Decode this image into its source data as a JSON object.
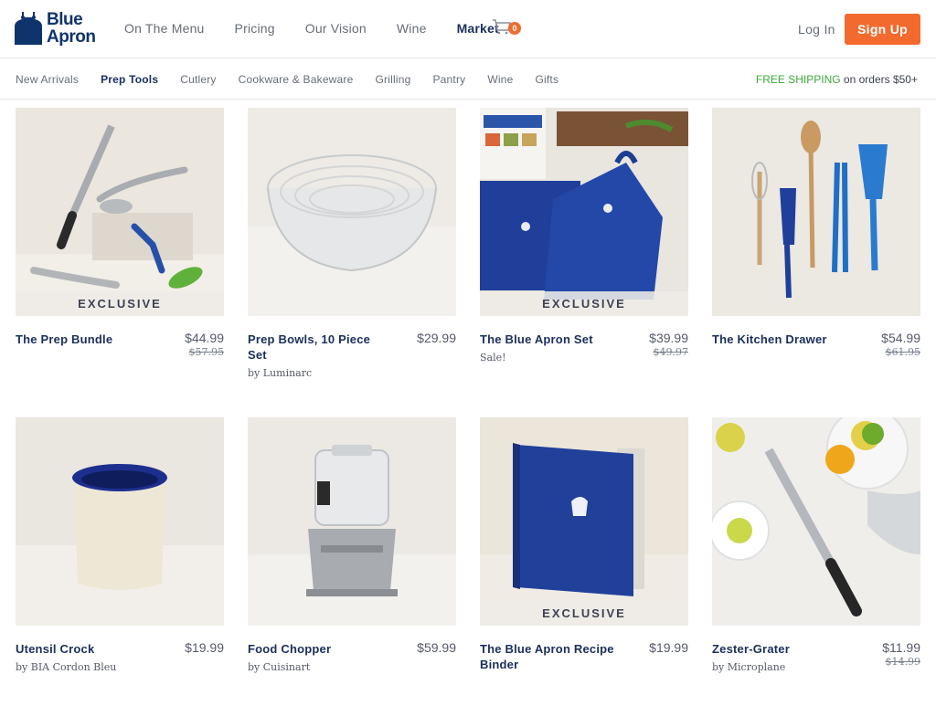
{
  "brand": {
    "line1": "Blue",
    "line2": "Apron"
  },
  "nav": [
    {
      "label": "On The Menu",
      "active": false
    },
    {
      "label": "Pricing",
      "active": false
    },
    {
      "label": "Our Vision",
      "active": false
    },
    {
      "label": "Wine",
      "active": false
    },
    {
      "label": "Market",
      "active": true
    }
  ],
  "cart": {
    "count": "0",
    "icon": "cart-icon"
  },
  "auth": {
    "login": "Log In",
    "signup": "Sign Up"
  },
  "colors": {
    "accent": "#f26a2e",
    "navy": "#1b2f5c",
    "green": "#3aa935"
  },
  "subnav": [
    {
      "label": "New Arrivals",
      "active": false
    },
    {
      "label": "Prep Tools",
      "active": true
    },
    {
      "label": "Cutlery",
      "active": false
    },
    {
      "label": "Cookware & Bakeware",
      "active": false
    },
    {
      "label": "Grilling",
      "active": false
    },
    {
      "label": "Pantry",
      "active": false
    },
    {
      "label": "Wine",
      "active": false
    },
    {
      "label": "Gifts",
      "active": false
    }
  ],
  "shipping": {
    "highlight": "FREE SHIPPING",
    "rest": " on orders $50+"
  },
  "products": [
    {
      "name": "The Prep Bundle",
      "price": "$44.99",
      "old_price": "$57.95",
      "sub": "",
      "badge": "EXCLUSIVE"
    },
    {
      "name": "Prep Bowls, 10 Piece Set",
      "price": "$29.99",
      "old_price": "",
      "sub": "by Luminarc",
      "badge": ""
    },
    {
      "name": "The Blue Apron Set",
      "price": "$39.99",
      "old_price": "$49.97",
      "sub": "Sale!",
      "badge": "EXCLUSIVE"
    },
    {
      "name": "The Kitchen Drawer",
      "price": "$54.99",
      "old_price": "$61.95",
      "sub": "",
      "badge": ""
    },
    {
      "name": "Utensil Crock",
      "price": "$19.99",
      "old_price": "",
      "sub": "by BIA Cordon Bleu",
      "badge": ""
    },
    {
      "name": "Food Chopper",
      "price": "$59.99",
      "old_price": "",
      "sub": "by Cuisinart",
      "badge": ""
    },
    {
      "name": "The Blue Apron Recipe Binder",
      "price": "$19.99",
      "old_price": "",
      "sub": "",
      "badge": "EXCLUSIVE"
    },
    {
      "name": "Zester-Grater",
      "price": "$11.99",
      "old_price": "$14.99",
      "sub": "by Microplane",
      "badge": ""
    }
  ]
}
